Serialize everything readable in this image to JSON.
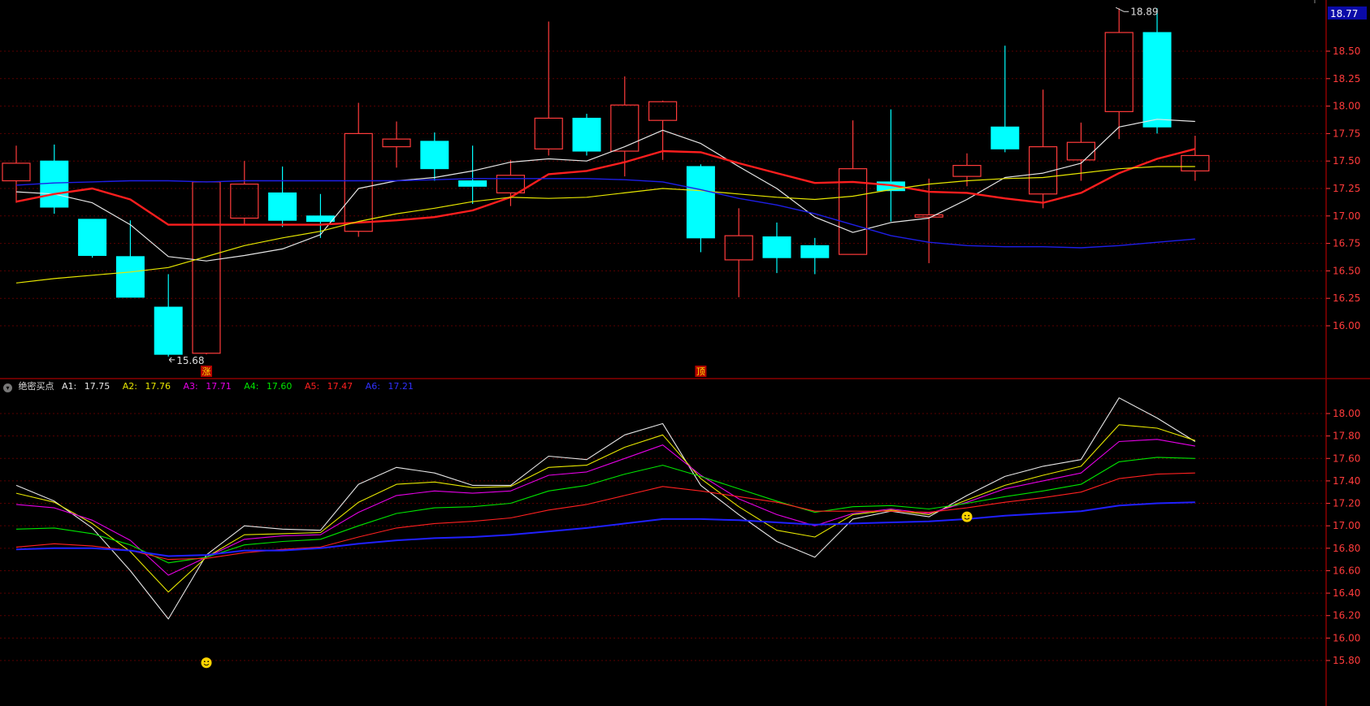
{
  "header": {
    "title": ""
  },
  "colors": {
    "background": "#000000",
    "panel_border": "#8b0000",
    "grid": "#5a0000",
    "axis_text": "#ff3b3b",
    "up": "#ff3b3b",
    "down": "#00ffff",
    "ma_white": "#e6e6e6",
    "ma_red": "#ff1e1e",
    "ma_yellow": "#e6e600",
    "ma_blue": "#1e1ee6"
  },
  "price_panel": {
    "current_price_tag": "18.77",
    "high_marker": "18.89",
    "low_marker": "15.68",
    "signal_labels": [
      {
        "text": "涨",
        "bar": 5
      },
      {
        "text": "顶",
        "bar": 18
      }
    ]
  },
  "indicator_panel": {
    "name": "绝密买点",
    "items": [
      {
        "label": "A1:",
        "value": "17.75",
        "color": "#e6e6e6"
      },
      {
        "label": "A2:",
        "value": "17.76",
        "color": "#e6e600"
      },
      {
        "label": "A3:",
        "value": "17.71",
        "color": "#e600e6"
      },
      {
        "label": "A4:",
        "value": "17.60",
        "color": "#00e600"
      },
      {
        "label": "A5:",
        "value": "17.47",
        "color": "#ff2020"
      },
      {
        "label": "A6:",
        "value": "17.21",
        "color": "#2020ff"
      }
    ]
  },
  "chart_data": [
    {
      "type": "candlestick",
      "yticks": [
        "18.50",
        "18.25",
        "18.00",
        "17.75",
        "17.50",
        "17.25",
        "17.00",
        "16.75",
        "16.50",
        "16.25",
        "16.00"
      ],
      "ylim": [
        15.55,
        19.0
      ],
      "candles": [
        {
          "o": 17.32,
          "c": 17.48,
          "h": 17.64,
          "l": 17.12
        },
        {
          "o": 17.5,
          "c": 17.08,
          "h": 17.65,
          "l": 17.02
        },
        {
          "o": 16.97,
          "c": 16.64,
          "h": 16.97,
          "l": 16.62
        },
        {
          "o": 16.63,
          "c": 16.26,
          "h": 16.96,
          "l": 16.26
        },
        {
          "o": 16.17,
          "c": 15.74,
          "h": 16.47,
          "l": 15.72
        },
        {
          "o": 15.75,
          "c": 17.31,
          "h": 17.31,
          "l": 15.74
        },
        {
          "o": 16.98,
          "c": 17.29,
          "h": 17.5,
          "l": 16.92
        },
        {
          "o": 17.21,
          "c": 16.96,
          "h": 17.45,
          "l": 16.9
        },
        {
          "o": 17.0,
          "c": 16.95,
          "h": 17.2,
          "l": 16.8
        },
        {
          "o": 16.86,
          "c": 17.75,
          "h": 18.03,
          "l": 16.81
        },
        {
          "o": 17.63,
          "c": 17.7,
          "h": 17.86,
          "l": 17.44
        },
        {
          "o": 17.68,
          "c": 17.43,
          "h": 17.76,
          "l": 17.32
        },
        {
          "o": 17.32,
          "c": 17.27,
          "h": 17.64,
          "l": 17.11
        },
        {
          "o": 17.21,
          "c": 17.37,
          "h": 17.51,
          "l": 17.09
        },
        {
          "o": 17.61,
          "c": 17.89,
          "h": 18.77,
          "l": 17.55
        },
        {
          "o": 17.89,
          "c": 17.59,
          "h": 17.93,
          "l": 17.55
        },
        {
          "o": 17.59,
          "c": 18.01,
          "h": 18.27,
          "l": 17.36
        },
        {
          "o": 17.87,
          "c": 18.04,
          "h": 18.05,
          "l": 17.51
        },
        {
          "o": 17.45,
          "c": 16.8,
          "h": 17.47,
          "l": 16.67
        },
        {
          "o": 16.6,
          "c": 16.82,
          "h": 17.07,
          "l": 16.26
        },
        {
          "o": 16.81,
          "c": 16.62,
          "h": 16.94,
          "l": 16.48
        },
        {
          "o": 16.73,
          "c": 16.62,
          "h": 16.8,
          "l": 16.47
        },
        {
          "o": 16.65,
          "c": 17.43,
          "h": 17.87,
          "l": 16.65
        },
        {
          "o": 17.31,
          "c": 17.23,
          "h": 17.97,
          "l": 16.95
        },
        {
          "o": 16.99,
          "c": 17.01,
          "h": 17.34,
          "l": 16.57
        },
        {
          "o": 17.36,
          "c": 17.46,
          "h": 17.57,
          "l": 17.27
        },
        {
          "o": 17.81,
          "c": 17.61,
          "h": 18.55,
          "l": 17.58
        },
        {
          "o": 17.2,
          "c": 17.63,
          "h": 18.15,
          "l": 17.07
        },
        {
          "o": 17.51,
          "c": 17.67,
          "h": 17.85,
          "l": 17.32
        },
        {
          "o": 17.95,
          "c": 18.67,
          "h": 18.89,
          "l": 17.7
        },
        {
          "o": 18.67,
          "c": 17.81,
          "h": 18.89,
          "l": 17.75
        },
        {
          "o": 17.41,
          "c": 17.55,
          "h": 17.73,
          "l": 17.32
        }
      ],
      "moving_averages": [
        {
          "name": "",
          "color": "#e6e6e6",
          "width": 1.2,
          "values": [
            17.22,
            17.2,
            17.12,
            16.92,
            16.63,
            16.59,
            16.64,
            16.7,
            16.83,
            17.25,
            17.32,
            17.35,
            17.41,
            17.49,
            17.52,
            17.5,
            17.63,
            17.78,
            17.66,
            17.45,
            17.25,
            16.99,
            16.85,
            16.94,
            16.98,
            17.15,
            17.35,
            17.39,
            17.48,
            17.81,
            17.88,
            17.86
          ]
        },
        {
          "name": "",
          "color": "#ff1e1e",
          "width": 2.4,
          "values": [
            17.13,
            17.2,
            17.25,
            17.15,
            16.92,
            16.92,
            16.92,
            16.92,
            16.92,
            16.94,
            16.96,
            16.99,
            17.05,
            17.17,
            17.38,
            17.41,
            17.49,
            17.59,
            17.58,
            17.48,
            17.39,
            17.3,
            17.31,
            17.28,
            17.22,
            17.21,
            17.16,
            17.12,
            17.21,
            17.39,
            17.52,
            17.61
          ]
        },
        {
          "name": "",
          "color": "#e6e600",
          "width": 1.2,
          "values": [
            16.39,
            16.43,
            16.46,
            16.49,
            16.53,
            16.63,
            16.73,
            16.8,
            16.86,
            16.95,
            17.02,
            17.07,
            17.13,
            17.17,
            17.16,
            17.17,
            17.21,
            17.25,
            17.23,
            17.2,
            17.17,
            17.15,
            17.18,
            17.24,
            17.29,
            17.32,
            17.34,
            17.35,
            17.39,
            17.43,
            17.45,
            17.45
          ]
        },
        {
          "name": "",
          "color": "#1e1ee6",
          "width": 1.4,
          "values": [
            17.28,
            17.3,
            17.31,
            17.32,
            17.32,
            17.31,
            17.32,
            17.32,
            17.32,
            17.32,
            17.32,
            17.33,
            17.34,
            17.34,
            17.34,
            17.34,
            17.33,
            17.31,
            17.24,
            17.16,
            17.1,
            17.02,
            16.92,
            16.82,
            16.76,
            16.73,
            16.72,
            16.72,
            16.71,
            16.73,
            16.76,
            16.79
          ]
        }
      ]
    },
    {
      "type": "line",
      "title": "绝密买点",
      "yticks": [
        "18.00",
        "17.80",
        "17.60",
        "17.40",
        "17.20",
        "17.00",
        "16.80",
        "16.60",
        "16.40",
        "16.20",
        "16.00",
        "15.80"
      ],
      "ylim": [
        15.7,
        18.24
      ],
      "series": [
        {
          "name": "A1",
          "color": "#e6e6e6",
          "width": 1.1,
          "values": [
            17.36,
            17.22,
            16.98,
            16.6,
            16.17,
            16.74,
            17.0,
            16.97,
            16.96,
            17.37,
            17.52,
            17.47,
            17.36,
            17.36,
            17.62,
            17.59,
            17.81,
            17.91,
            17.36,
            17.1,
            16.86,
            16.72,
            17.06,
            17.13,
            17.08,
            17.27,
            17.44,
            17.53,
            17.59,
            18.14,
            17.96,
            17.75
          ]
        },
        {
          "name": "A2",
          "color": "#e6e600",
          "width": 1.1,
          "values": [
            17.29,
            17.21,
            17.02,
            16.77,
            16.41,
            16.72,
            16.92,
            16.93,
            16.94,
            17.21,
            17.37,
            17.39,
            17.34,
            17.35,
            17.52,
            17.54,
            17.7,
            17.81,
            17.42,
            17.17,
            16.96,
            16.9,
            17.1,
            17.14,
            17.1,
            17.23,
            17.36,
            17.45,
            17.53,
            17.9,
            17.87,
            17.76
          ]
        },
        {
          "name": "A3",
          "color": "#e600e6",
          "width": 1.1,
          "values": [
            17.19,
            17.16,
            17.05,
            16.87,
            16.56,
            16.72,
            16.88,
            16.91,
            16.92,
            17.12,
            17.27,
            17.31,
            17.29,
            17.31,
            17.45,
            17.48,
            17.6,
            17.72,
            17.45,
            17.24,
            17.1,
            17.0,
            17.11,
            17.15,
            17.11,
            17.21,
            17.33,
            17.4,
            17.47,
            17.75,
            17.77,
            17.71
          ]
        },
        {
          "name": "A4",
          "color": "#00e600",
          "width": 1.1,
          "values": [
            16.97,
            16.98,
            16.93,
            16.83,
            16.67,
            16.72,
            16.83,
            16.86,
            16.88,
            17.0,
            17.11,
            17.16,
            17.17,
            17.2,
            17.31,
            17.36,
            17.46,
            17.54,
            17.44,
            17.33,
            17.22,
            17.12,
            17.17,
            17.18,
            17.15,
            17.2,
            17.26,
            17.31,
            17.37,
            17.57,
            17.61,
            17.6
          ]
        },
        {
          "name": "A5",
          "color": "#ff2020",
          "width": 1.1,
          "values": [
            16.81,
            16.84,
            16.82,
            16.78,
            16.7,
            16.71,
            16.76,
            16.79,
            16.81,
            16.9,
            16.98,
            17.02,
            17.04,
            17.07,
            17.14,
            17.19,
            17.27,
            17.35,
            17.31,
            17.26,
            17.21,
            17.13,
            17.13,
            17.13,
            17.12,
            17.16,
            17.21,
            17.25,
            17.3,
            17.42,
            17.46,
            17.47
          ]
        },
        {
          "name": "A6",
          "color": "#2020ff",
          "width": 2.0,
          "values": [
            16.79,
            16.8,
            16.8,
            16.78,
            16.73,
            16.74,
            16.78,
            16.78,
            16.8,
            16.84,
            16.87,
            16.89,
            16.9,
            16.92,
            16.95,
            16.98,
            17.02,
            17.06,
            17.06,
            17.05,
            17.03,
            17.01,
            17.02,
            17.03,
            17.04,
            17.06,
            17.09,
            17.11,
            17.13,
            17.18,
            17.2,
            17.21
          ]
        }
      ],
      "signals": [
        {
          "bar": 5,
          "value": 15.78,
          "icon": "smiley-icon"
        },
        {
          "bar": 25,
          "value": 17.08,
          "icon": "smiley-icon"
        }
      ]
    }
  ]
}
